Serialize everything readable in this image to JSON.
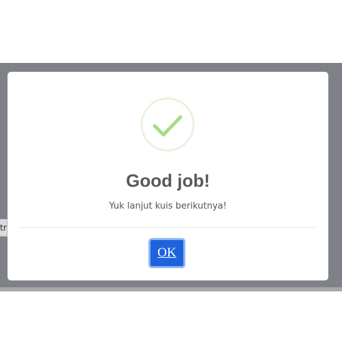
{
  "underlay": {
    "field_text": "tr"
  },
  "dialog": {
    "icon": "success-check-icon",
    "title": "Good job!",
    "message": "Yuk lanjut kuis berikutnya!",
    "confirm_label": "OK"
  },
  "colors": {
    "backdrop": "#7f8188",
    "success_ring": "#e6f4df",
    "success_check": "#a5dc86",
    "confirm_button": "#1d63dc",
    "confirm_focus_ring": "#8fb6f4",
    "title_text": "#595959",
    "message_text": "#545454"
  }
}
